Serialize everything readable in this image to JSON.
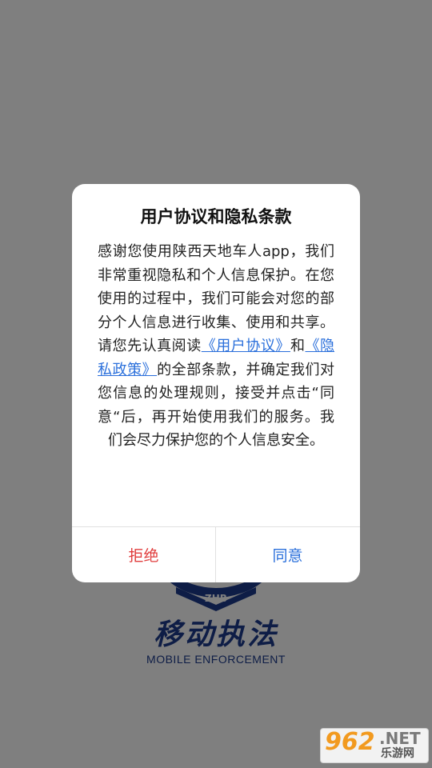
{
  "splash": {
    "logo_icon": "zhb-shield-logo",
    "logo_text": "ZHB",
    "title": "移动执法",
    "subtitle": "MOBILE ENFORCEMENT",
    "brand_color": "#1c3a8c"
  },
  "dialog": {
    "title": "用户协议和隐私条款",
    "body_part1": "感谢您使用陕西天地车人app，我们非常重视隐私和个人信息保护。在您使用的过程中，我们可能会对您的部分个人信息进行收集、使用和共享。请您先认真阅读",
    "link_user_agreement": "《用户协议》",
    "body_and": "和",
    "link_privacy_policy": "《隐私政策》",
    "body_part2": "的全部条款，并确定我们对您信息的处理规则，接受并点击“同意“后，再开始使用我们的服务。我们会尽力保护您的个人信息安全。",
    "reject_label": "拒绝",
    "agree_label": "同意",
    "link_color": "#2a6fdb",
    "reject_color": "#e03c3c"
  },
  "watermark": {
    "number": "962",
    "domain": ".NET",
    "name": "乐游网"
  }
}
